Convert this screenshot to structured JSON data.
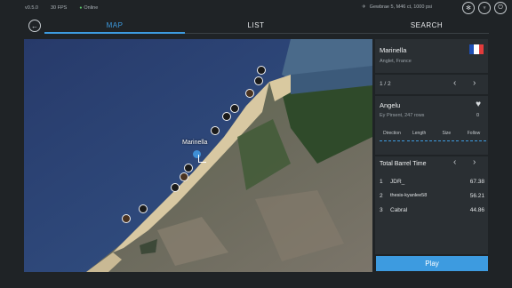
{
  "status": {
    "version": "v0.5.0",
    "fps": "30 FPS",
    "online": "Online",
    "location": "Gewbrae 5, M46 ct, 1000 psi"
  },
  "top_icons": [
    "settings-icon",
    "trophy-icon",
    "power-icon"
  ],
  "tabs": {
    "map": "MAP",
    "list": "LIST",
    "search": "SEARCH"
  },
  "map": {
    "label": "Marinella"
  },
  "spot": {
    "name": "Marinella",
    "region": "Anglet, France",
    "flag_colors": [
      "#1f4fb5",
      "#ffffff",
      "#e23b3b"
    ]
  },
  "pager": {
    "text": "1 / 2"
  },
  "wave": {
    "name": "Angelu",
    "sub": "Ey Pirsent, 247 rows",
    "likes": "0",
    "metrics": [
      "Direction",
      "Length",
      "Size",
      "Follow"
    ]
  },
  "leaderboard": {
    "title": "Total Barrel Time",
    "rows": [
      {
        "rank": "1",
        "user": "JDR_",
        "score": "67.38"
      },
      {
        "rank": "2",
        "user": "thesis-kyanlee58",
        "score": "56.21"
      },
      {
        "rank": "3",
        "user": "Cabral",
        "score": "44.86"
      }
    ]
  },
  "play_label": "Play"
}
